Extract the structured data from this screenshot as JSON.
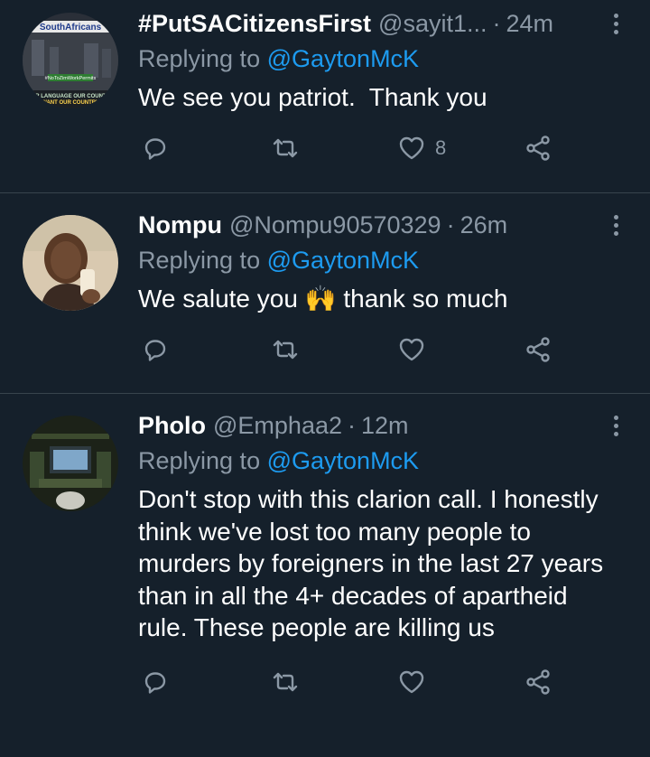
{
  "tweets": [
    {
      "name": "#PutSACitizensFirst",
      "handle": "@sayit1...",
      "separator": "·",
      "time": "24m",
      "replying_prefix": "Replying to",
      "replying_to": "@GaytonMcK",
      "text": "We see you patriot.  Thank you",
      "like_count": "8",
      "avatar_banner": "SouthAfricans",
      "avatar_tag": "#NoToZimWorkPermits",
      "avatar_footer_1": "OUR LANGUAGE OUR COUNTRY",
      "avatar_footer_2": "WANT OUR COUNTRY"
    },
    {
      "name": "Nompu",
      "handle": "@Nompu90570329",
      "separator": "·",
      "time": "26m",
      "replying_prefix": "Replying to",
      "replying_to": "@GaytonMcK",
      "text_before_emoji": "We salute you ",
      "emoji": "🙌",
      "text_after_emoji": " thank so much",
      "like_count": ""
    },
    {
      "name": "Pholo",
      "handle": "@Emphaa2",
      "separator": "·",
      "time": "12m",
      "replying_prefix": "Replying to",
      "replying_to": "@GaytonMcK",
      "text": "Don't stop with this clarion call. I honestly think we've lost too many people to murders by foreigners in the last 27 years than in all the 4+ decades of apartheid rule. These people are killing us",
      "like_count": ""
    }
  ],
  "icons": {
    "reply": "reply-icon",
    "retweet": "retweet-icon",
    "like": "heart-icon",
    "share": "share-icon",
    "more": "more-icon"
  },
  "colors": {
    "background": "#15202b",
    "secondary_text": "#8b98a5",
    "mention": "#1d9bf0",
    "divider": "#38444d"
  }
}
